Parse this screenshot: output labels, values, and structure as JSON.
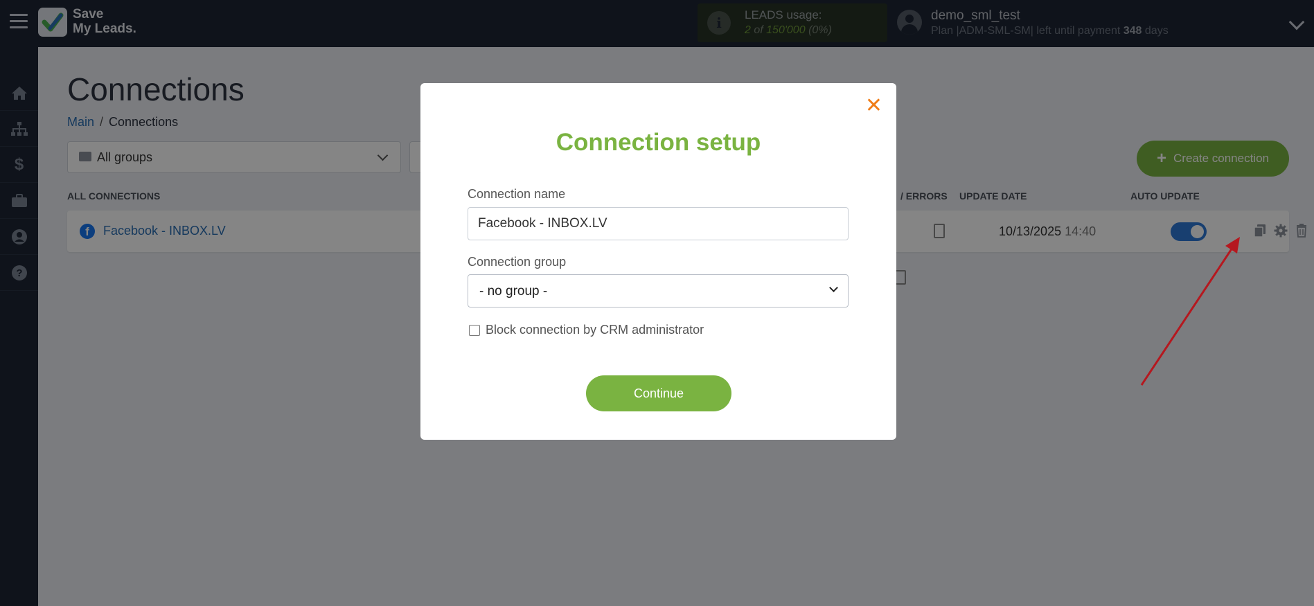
{
  "app": {
    "logo_line1": "Save",
    "logo_line2": "My Leads."
  },
  "leads": {
    "title": "LEADS usage:",
    "used": "2",
    "of_label": "of",
    "total": "150'000",
    "percent": "(0%)"
  },
  "user": {
    "name": "demo_sml_test",
    "plan_prefix": "Plan |ADM-SML-SM| left until payment",
    "days": "348",
    "days_suffix": "days"
  },
  "sidebar": {
    "items": [
      {
        "icon": "home-icon",
        "glyph": "⌂"
      },
      {
        "icon": "sitemap-icon",
        "glyph": "⊞"
      },
      {
        "icon": "dollar-icon",
        "glyph": "$"
      },
      {
        "icon": "briefcase-icon",
        "glyph": "▬"
      },
      {
        "icon": "user-icon",
        "glyph": "●"
      },
      {
        "icon": "help-icon",
        "glyph": "?"
      }
    ]
  },
  "page": {
    "title": "Connections",
    "breadcrumb_main": "Main",
    "breadcrumb_sep": "/",
    "breadcrumb_current": "Connections",
    "group_filter": "All groups",
    "create_button": "Create connection"
  },
  "table": {
    "headers": {
      "all": "ALL CONNECTIONS",
      "errors": "/ ERRORS",
      "update_date": "UPDATE DATE",
      "auto_update": "AUTO UPDATE"
    },
    "rows": [
      {
        "name": "Facebook - INBOX.LV",
        "date": "10/13/2025",
        "time": "14:40",
        "auto_update": true
      }
    ]
  },
  "modal": {
    "title": "Connection setup",
    "name_label": "Connection name",
    "name_value": "Facebook - INBOX.LV",
    "group_label": "Connection group",
    "group_value": "- no group -",
    "block_label": "Block connection by CRM administrator",
    "block_checked": false,
    "continue_label": "Continue",
    "close_glyph": "✕"
  },
  "colors": {
    "accent_green": "#7ab341",
    "close_orange": "#f07d18",
    "toggle_blue": "#2f7ad6",
    "annotation_red": "#b5181f"
  }
}
